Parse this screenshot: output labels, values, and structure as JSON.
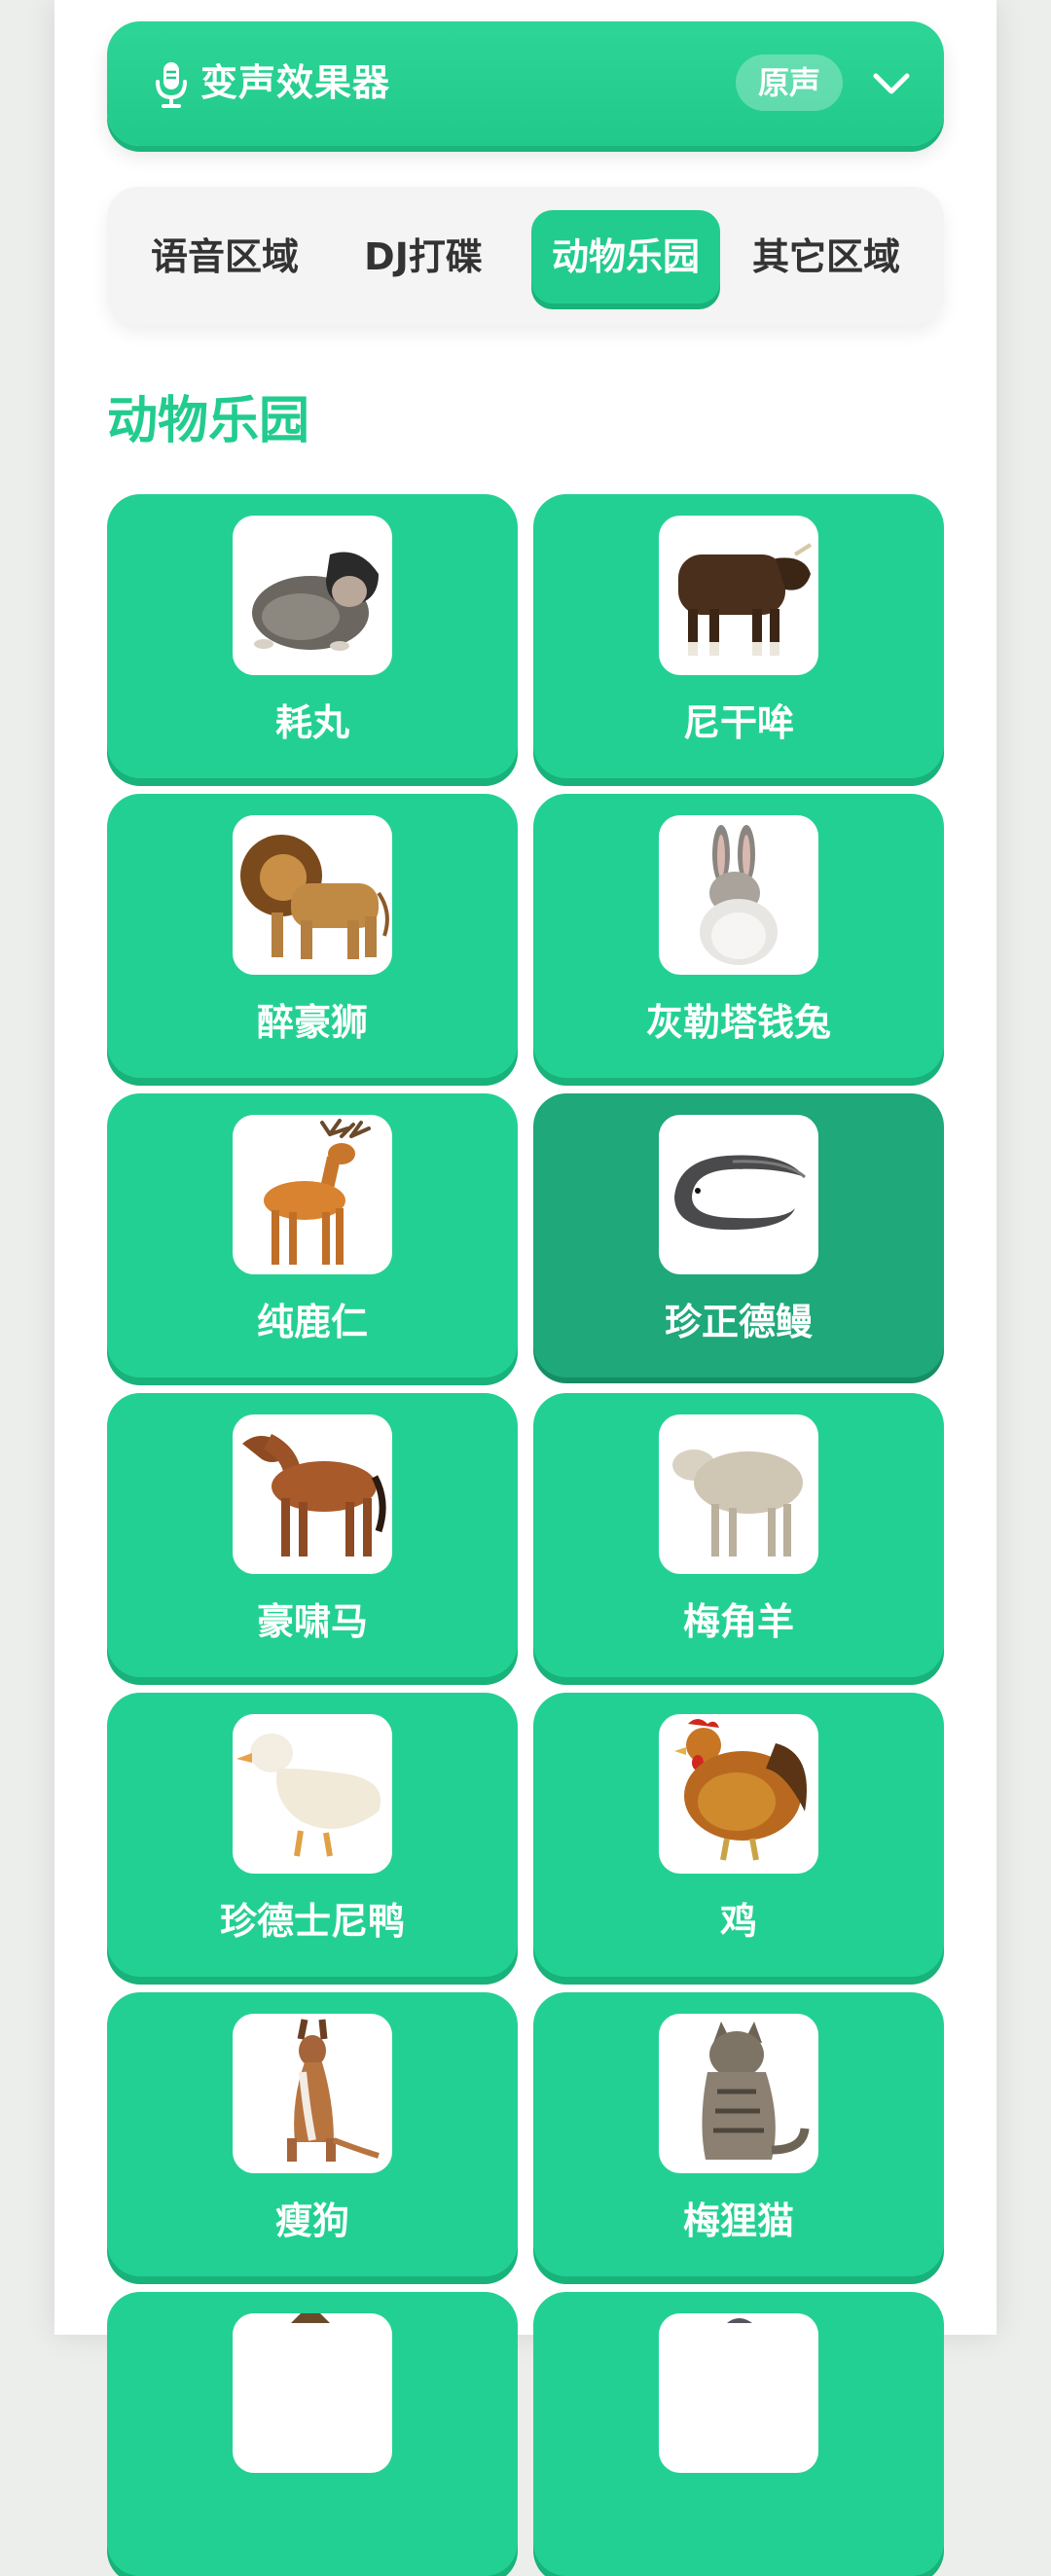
{
  "header": {
    "title": "变声效果器",
    "badge": "原声",
    "mic_icon": "mic-icon",
    "dropdown_icon": "chevron-down-icon"
  },
  "tabs": [
    {
      "label": "语音区域",
      "active": false
    },
    {
      "label": "DJ打碟",
      "active": false
    },
    {
      "label": "动物乐园",
      "active": true
    },
    {
      "label": "其它区域",
      "active": false
    }
  ],
  "section": {
    "title": "动物乐园"
  },
  "cards": [
    {
      "label": "耗丸",
      "image": "hamster-image"
    },
    {
      "label": "尼干哞",
      "image": "bull-image"
    },
    {
      "label": "醉豪狮",
      "image": "lion-image"
    },
    {
      "label": "灰勒塔钱兔",
      "image": "rabbit-image"
    },
    {
      "label": "纯鹿仁",
      "image": "deer-image"
    },
    {
      "label": "珍正德鳗",
      "image": "eel-image"
    },
    {
      "label": "豪啸马",
      "image": "horse-image"
    },
    {
      "label": "梅角羊",
      "image": "sheep-image"
    },
    {
      "label": "珍德士尼鸭",
      "image": "duck-image"
    },
    {
      "label": "鸡",
      "image": "chicken-image"
    },
    {
      "label": "瘦狗",
      "image": "dog-image"
    },
    {
      "label": "梅狸猫",
      "image": "cat-image"
    },
    {
      "label": "",
      "image": "partial-card-image"
    },
    {
      "label": "",
      "image": "partial-card-image"
    }
  ],
  "colors": {
    "primary": "#22cc8e",
    "primary_dark": "#18b27a",
    "pressed": "#1fa87a",
    "background": "#eceeec"
  }
}
